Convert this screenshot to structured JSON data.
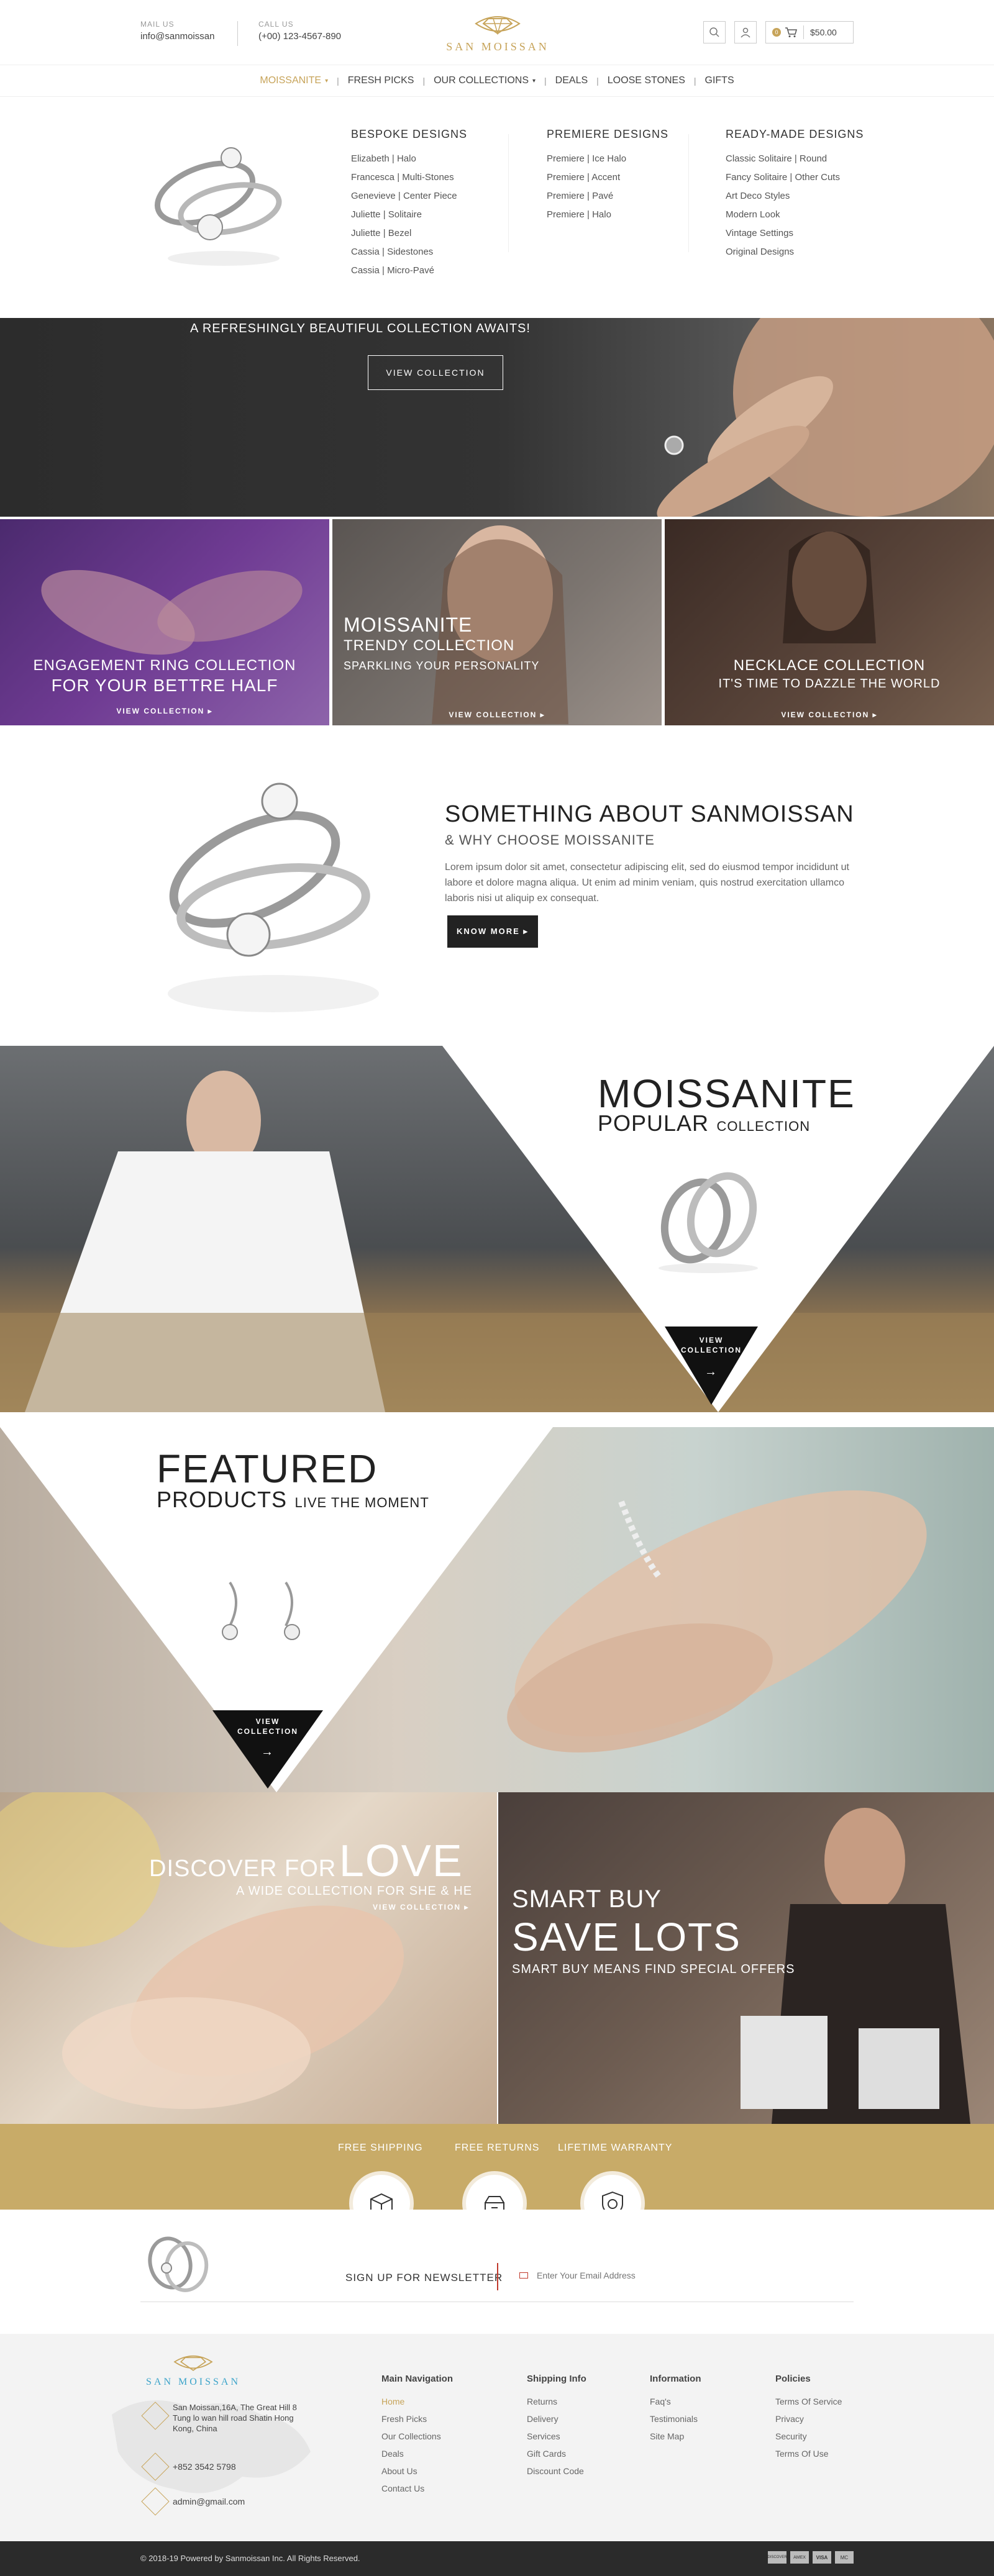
{
  "header": {
    "mail_label": "MAIL US",
    "mail_value": "info@sanmoissan",
    "call_label": "CALL US",
    "call_value": "(+00) 123-4567-890",
    "logo_text": "SAN MOISSAN",
    "cart_count": "0",
    "cart_total": "$50.00"
  },
  "nav": {
    "items": [
      "MOISSANITE",
      "FRESH PICKS",
      "OUR COLLECTIONS",
      "DEALS",
      "LOOSE STONES",
      "GIFTS"
    ]
  },
  "mega": {
    "col1_title": "BESPOKE DESIGNS",
    "col1_links": [
      "Elizabeth | Halo",
      "Francesca | Multi-Stones",
      "Genevieve | Center Piece",
      "Juliette | Solitaire",
      "Juliette | Bezel",
      "Cassia | Sidestones",
      "Cassia | Micro-Pavé"
    ],
    "col2_title": "PREMIERE DESIGNS",
    "col2_links": [
      "Premiere | Ice Halo",
      "Premiere | Accent",
      "Premiere | Pavé",
      "Premiere | Halo"
    ],
    "col3_title": "READY-MADE DESIGNS",
    "col3_links": [
      "Classic Solitaire | Round",
      "Fancy Solitaire | Other Cuts",
      "Art Deco Styles",
      "Modern Look",
      "Vintage Settings",
      "Original Designs"
    ]
  },
  "hero": {
    "tagline": "A REFRESHINGLY BEAUTIFUL COLLECTION AWAITS!",
    "button": "VIEW COLLECTION"
  },
  "tiles": [
    {
      "line1": "ENGAGEMENT RING COLLECTION",
      "line2": "FOR YOUR BETTRE HALF",
      "link": "VIEW COLLECTION ▸"
    },
    {
      "line1": "MOISSANITE",
      "line2": "TRENDY COLLECTION",
      "line3": "SPARKLING YOUR PERSONALITY",
      "link": "VIEW COLLECTION ▸"
    },
    {
      "line1": "NECKLACE COLLECTION",
      "line2": "IT'S TIME TO DAZZLE THE WORLD",
      "link": "VIEW COLLECTION ▸"
    }
  ],
  "about": {
    "title": "SOMETHING ABOUT SANMOISSAN",
    "subtitle": "& WHY CHOOSE MOISSANITE",
    "body": "Lorem ipsum dolor sit amet, consectetur adipiscing elit, sed do eiusmod tempor incididunt ut labore et dolore magna aliqua. Ut enim ad minim veniam, quis nostrud exercitation ullamco laboris nisi ut aliquip ex consequat.",
    "button": "KNOW MORE ▸"
  },
  "popular": {
    "title": "MOISSANITE",
    "sub_big": "POPULAR",
    "sub_small": "COLLECTION",
    "button_line1": "VIEW",
    "button_line2": "COLLECTION"
  },
  "featured": {
    "title": "FEATURED",
    "sub_big": "PRODUCTS",
    "sub_small": "LIVE THE MOMENT",
    "button_line1": "VIEW",
    "button_line2": "COLLECTION"
  },
  "love": {
    "line1_small": "DISCOVER FOR",
    "line1_big": "LOVE",
    "line2": "A WIDE COLLECTION FOR SHE & HE",
    "link": "VIEW COLLECTION ▸"
  },
  "smart": {
    "line1": "SMART BUY",
    "line2": "SAVE LOTS",
    "line3": "SMART BUY MEANS FIND SPECIAL OFFERS"
  },
  "benefits": [
    "FREE SHIPPING",
    "FREE RETURNS",
    "LIFETIME WARRANTY"
  ],
  "newsletter": {
    "label": "SIGN UP FOR NEWSLETTER",
    "placeholder": "Enter Your Email Address"
  },
  "footer": {
    "logo_text": "SAN MOISSAN",
    "address": "San Moissan,16A, The Great Hill 8 Tung lo wan hill road Shatin Hong Kong, China",
    "phone": "+852 3542 5798",
    "email": "admin@gmail.com",
    "col1_title": "Main Navigation",
    "col1_links": [
      "Home",
      "Fresh Picks",
      "Our Collections",
      "Deals",
      "About Us",
      "Contact Us"
    ],
    "col2_title": "Shipping Info",
    "col2_links": [
      "Returns",
      "Delivery",
      "Services",
      "Gift Cards",
      "Discount Code"
    ],
    "col3_title": "Information",
    "col3_links": [
      "Faq's",
      "Testimonials",
      "Site Map"
    ],
    "col4_title": "Policies",
    "col4_links": [
      "Terms Of Service",
      "Privacy",
      "Security",
      "Terms Of Use"
    ]
  },
  "copyright": "© 2018-19 Powered by Sanmoissan Inc. All Rights Reserved.",
  "payments": [
    "DISCOVER",
    "AMEX",
    "VISA",
    "MC"
  ],
  "colors": {
    "gold": "#c8ab68",
    "dark": "#2b2b2b"
  }
}
